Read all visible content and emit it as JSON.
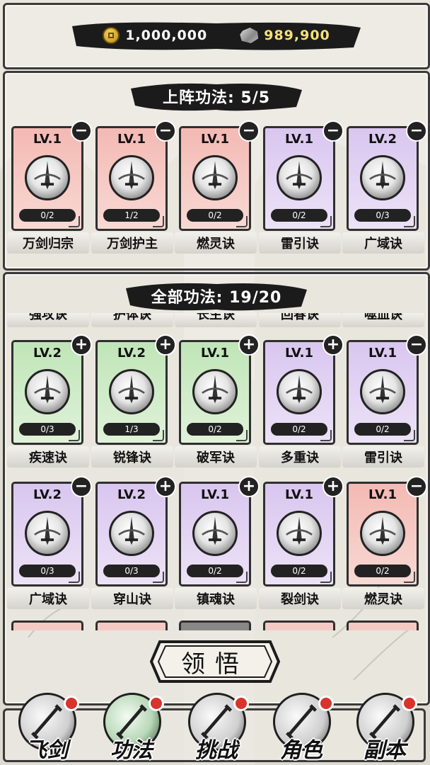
{
  "currency": {
    "coins": "1,000,000",
    "ore": "989,900",
    "coin_icon": "coin-icon",
    "ore_icon": "ore-icon",
    "ore_color": "#f4e07a"
  },
  "equipped": {
    "title": "上阵功法: 5/5",
    "cards": [
      {
        "lv": "LV.1",
        "progress": "0/2",
        "name": "万剑归宗",
        "color": "red",
        "action": "−",
        "icon": "sword-orb-icon"
      },
      {
        "lv": "LV.1",
        "progress": "1/2",
        "name": "万剑护主",
        "color": "red",
        "action": "−",
        "icon": "swirl-guard-icon"
      },
      {
        "lv": "LV.1",
        "progress": "0/2",
        "name": "燃灵诀",
        "color": "red",
        "action": "−",
        "icon": "flame-sword-icon"
      },
      {
        "lv": "LV.1",
        "progress": "0/2",
        "name": "雷引诀",
        "color": "purple",
        "action": "−",
        "icon": "thunder-sword-icon"
      },
      {
        "lv": "LV.2",
        "progress": "0/3",
        "name": "广域诀",
        "color": "purple",
        "action": "−",
        "icon": "whirl-sword-icon"
      }
    ]
  },
  "all": {
    "title": "全部功法: 19/20",
    "clipped_top": [
      "强攻诀",
      "护体诀",
      "长生诀",
      "回春诀",
      "噬血诀"
    ],
    "rows": [
      [
        {
          "lv": "LV.2",
          "progress": "0/3",
          "name": "疾速诀",
          "color": "green",
          "action": "+",
          "icon": "triple-sword-icon"
        },
        {
          "lv": "LV.2",
          "progress": "1/3",
          "name": "锐锋诀",
          "color": "green",
          "action": "+",
          "icon": "sharp-sword-icon"
        },
        {
          "lv": "LV.1",
          "progress": "0/2",
          "name": "破军诀",
          "color": "green",
          "action": "+",
          "icon": "shatter-sword-icon"
        },
        {
          "lv": "LV.1",
          "progress": "0/2",
          "name": "多重诀",
          "color": "purple",
          "action": "+",
          "icon": "multi-sword-icon"
        },
        {
          "lv": "LV.1",
          "progress": "0/2",
          "name": "雷引诀",
          "color": "purple",
          "action": "−",
          "icon": "thunder-sword-icon"
        }
      ],
      [
        {
          "lv": "LV.2",
          "progress": "0/3",
          "name": "广域诀",
          "color": "purple",
          "action": "−",
          "icon": "whirl-sword-icon"
        },
        {
          "lv": "LV.2",
          "progress": "0/3",
          "name": "穿山诀",
          "color": "purple",
          "action": "+",
          "icon": "pierce-sword-icon"
        },
        {
          "lv": "LV.1",
          "progress": "0/2",
          "name": "镇魂诀",
          "color": "purple",
          "action": "+",
          "icon": "seal-sword-icon"
        },
        {
          "lv": "LV.1",
          "progress": "0/2",
          "name": "裂剑诀",
          "color": "purple",
          "action": "+",
          "icon": "burst-sword-icon"
        },
        {
          "lv": "LV.1",
          "progress": "0/2",
          "name": "燃灵诀",
          "color": "red",
          "action": "−",
          "icon": "flame-sword-icon"
        }
      ]
    ]
  },
  "learn_button": "领悟",
  "nav": [
    {
      "label": "飞剑",
      "icon": "flying-sword-icon",
      "active": false
    },
    {
      "label": "功法",
      "icon": "scroll-icon",
      "active": true
    },
    {
      "label": "挑战",
      "icon": "crossed-swords-icon",
      "active": false
    },
    {
      "label": "角色",
      "icon": "character-icon",
      "active": false
    },
    {
      "label": "副本",
      "icon": "dungeon-gate-icon",
      "active": false
    }
  ],
  "colors": {
    "red": "#f4b9b3",
    "purple": "#d9c6ef",
    "green": "#bfe5b7",
    "notify": "#d8332c"
  }
}
